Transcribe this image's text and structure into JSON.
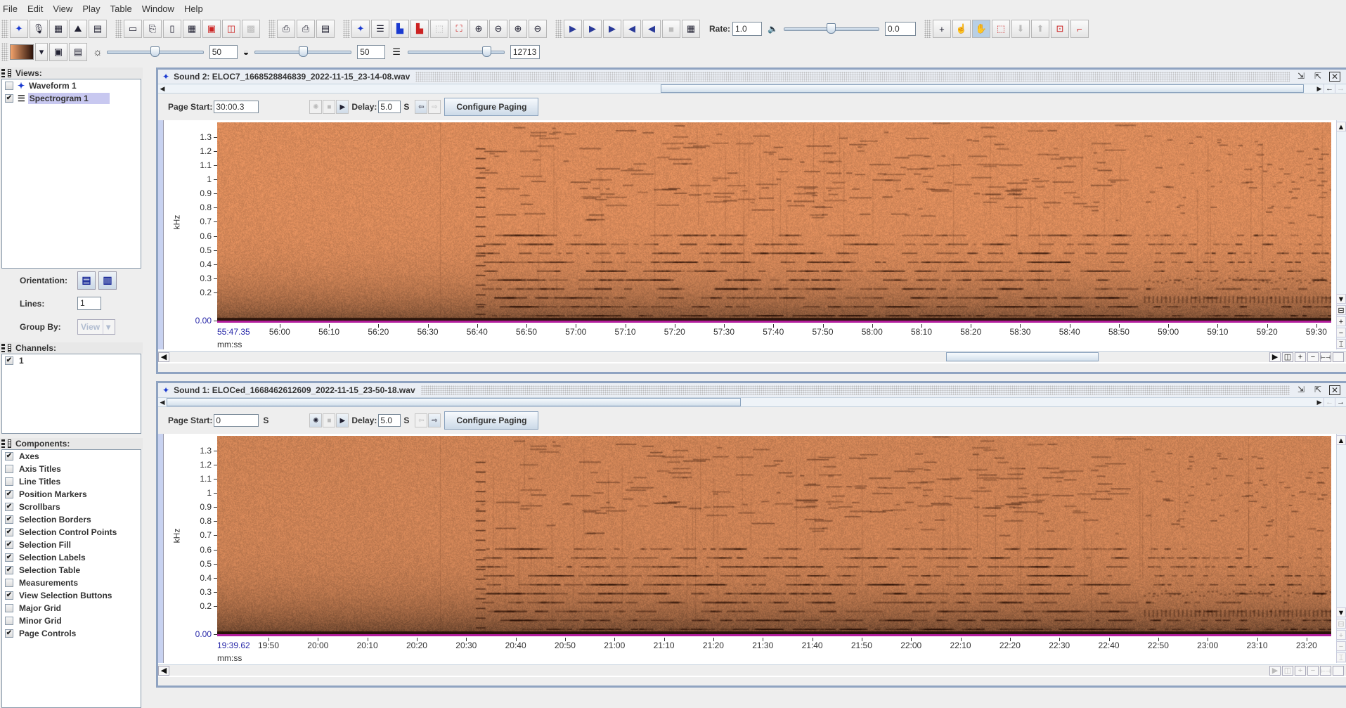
{
  "menu": [
    {
      "label": "File",
      "mnemonic": "F"
    },
    {
      "label": "Edit",
      "mnemonic": "E"
    },
    {
      "label": "View",
      "mnemonic": "V"
    },
    {
      "label": "Play",
      "mnemonic": "P"
    },
    {
      "label": "Table",
      "mnemonic": "a"
    },
    {
      "label": "Window",
      "mnemonic": "W"
    },
    {
      "label": "Help",
      "mnemonic": "H"
    }
  ],
  "toolbar": {
    "file_icons": [
      "new-sound-icon",
      "record-icon",
      "table-icon",
      "open-icon",
      "open-table-icon"
    ],
    "save_icons": [
      "save-icon",
      "save-as-icon",
      "save-selection-icon",
      "save-table-icon",
      "export-icon",
      "export-all-icon",
      "disabled-save-icon"
    ],
    "print_icons": [
      "print-icon",
      "print-preview-icon",
      "page-setup-icon"
    ],
    "view_icons": [
      "waveform-view-icon",
      "spectrogram-view-icon",
      "spectrum-icon",
      "spectrum-red-icon"
    ],
    "zoom_icons": [
      "zoom-to-selection-disabled-icon",
      "zoom-fit-icon",
      "zoom-in-icon",
      "zoom-out-icon",
      "zoom-in-y-icon",
      "zoom-out-y-icon"
    ],
    "play_icons": [
      "play-icon",
      "play-page-icon",
      "play-forward-icon",
      "play-reverse-icon",
      "rewind-icon",
      "stop-icon",
      "play-filtered-icon"
    ],
    "rate_label": "Rate:",
    "rate_value": "1.0",
    "volume_value": "0.0",
    "volume_fraction": 0.5,
    "tool_icons": [
      "crosshair-icon",
      "pointer-hand-icon",
      "pan-hand-icon",
      "selection-box-icon",
      "arrow-down-icon",
      "arrow-up-icon",
      "lock-selection-icon",
      "selection-corner-icon"
    ],
    "active_tool": "pan-hand-icon"
  },
  "display_bar": {
    "brightness_value": "50",
    "brightness_fraction": 0.5,
    "contrast_value": "50",
    "contrast_fraction": 0.5,
    "resolution_value": "12713",
    "resolution_fraction": 0.85
  },
  "views_panel": {
    "title": "Views:",
    "items": [
      {
        "label": "Waveform 1",
        "checked": false,
        "icon": "waveform-icon"
      },
      {
        "label": "Spectrogram 1",
        "checked": true,
        "icon": "spectrogram-icon",
        "selected": true
      }
    ],
    "orientation_label": "Orientation:",
    "lines_label": "Lines:",
    "lines_value": "1",
    "group_by_label": "Group By:",
    "group_by_value": "View"
  },
  "channels_panel": {
    "title": "Channels:",
    "items": [
      {
        "label": "1",
        "checked": true
      }
    ]
  },
  "components_panel": {
    "title": "Components:",
    "items": [
      {
        "label": "Axes",
        "checked": true
      },
      {
        "label": "Axis Titles",
        "checked": false
      },
      {
        "label": "Line Titles",
        "checked": false
      },
      {
        "label": "Position Markers",
        "checked": true
      },
      {
        "label": "Scrollbars",
        "checked": true
      },
      {
        "label": "Selection Borders",
        "checked": true
      },
      {
        "label": "Selection Control Points",
        "checked": true
      },
      {
        "label": "Selection Fill",
        "checked": true
      },
      {
        "label": "Selection Labels",
        "checked": true
      },
      {
        "label": "Selection Table",
        "checked": true
      },
      {
        "label": "Measurements",
        "checked": false
      },
      {
        "label": "View Selection Buttons",
        "checked": true
      },
      {
        "label": "Major Grid",
        "checked": false
      },
      {
        "label": "Minor Grid",
        "checked": false
      },
      {
        "label": "Page Controls",
        "checked": true
      }
    ]
  },
  "sounds": [
    {
      "title": "Sound 2: ELOC7_1668528846839_2022-11-15_23-14-08.wav",
      "page_start_label": "Page Start:",
      "page_start_value": "30:00.3",
      "page_start_unit": "",
      "delay_label": "Delay:",
      "delay_value": "5.0",
      "delay_unit": "S",
      "configure_label": "Configure Paging",
      "back_enabled": true,
      "forward_enabled": false,
      "overview_scroll": [
        0.43,
        0.99
      ],
      "time_scroll": [
        0.7,
        0.8
      ],
      "y_unit": "kHz",
      "x_unit": "mm:ss",
      "y_ticks": [
        "1.3",
        "1.2",
        "1.1",
        "1",
        "0.9",
        "0.8",
        "0.7",
        "0.6",
        "0.5",
        "0.4",
        "0.3",
        "0.2",
        "0.00"
      ],
      "x_start_label": "55:47.35",
      "x_ticks": [
        "56:00",
        "56:10",
        "56:20",
        "56:30",
        "56:40",
        "56:50",
        "57:00",
        "57:10",
        "57:20",
        "57:30",
        "57:40",
        "57:50",
        "58:00",
        "58:10",
        "58:20",
        "58:30",
        "58:40",
        "58:50",
        "59:00",
        "59:10",
        "59:20",
        "59:30"
      ],
      "x_start_seconds": 3347.35,
      "x_end_seconds": 3573,
      "y_max_khz": 1.37,
      "activity_onset_label": "56:40"
    },
    {
      "title": "Sound 1: ELOCed_1668462612609_2022-11-15_23-50-18.wav",
      "page_start_label": "Page Start:",
      "page_start_value": "0",
      "page_start_unit": "S",
      "delay_label": "Delay:",
      "delay_value": "5.0",
      "delay_unit": "S",
      "configure_label": "Configure Paging",
      "back_enabled": false,
      "forward_enabled": true,
      "overview_scroll": [
        0.0,
        0.5
      ],
      "time_scroll": [
        0.0,
        0.0
      ],
      "y_unit": "kHz",
      "x_unit": "mm:ss",
      "y_ticks": [
        "1.3",
        "1.2",
        "1.1",
        "1",
        "0.9",
        "0.8",
        "0.7",
        "0.6",
        "0.5",
        "0.4",
        "0.3",
        "0.2",
        "0.00"
      ],
      "x_start_label": "19:39.62",
      "x_ticks": [
        "19:50",
        "20:00",
        "20:10",
        "20:20",
        "20:30",
        "20:40",
        "20:50",
        "21:00",
        "21:10",
        "21:20",
        "21:30",
        "21:40",
        "21:50",
        "22:00",
        "22:10",
        "22:20",
        "22:30",
        "22:40",
        "22:50",
        "23:00",
        "23:10",
        "23:20"
      ],
      "x_start_seconds": 1179.62,
      "x_end_seconds": 1405,
      "y_max_khz": 1.37,
      "activity_onset_label": "20:30"
    }
  ],
  "colors": {
    "spectrogram_base": "#d98a5a",
    "spectrogram_dark": "#3a1a0c",
    "position_marker": "#b21d9c",
    "start_label": "#2626a8",
    "window_border": "#8fa3c1"
  }
}
